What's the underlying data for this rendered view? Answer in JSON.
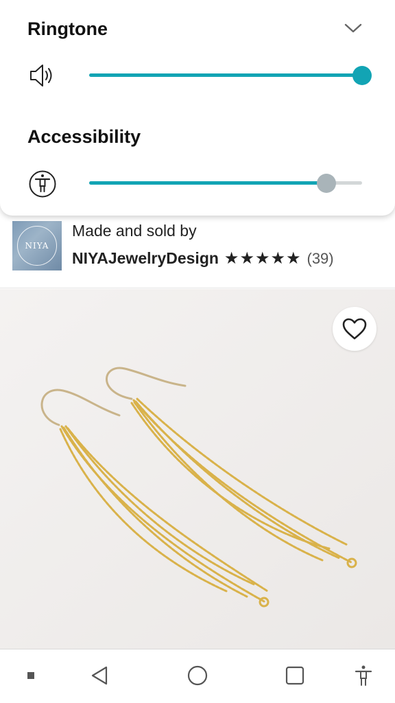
{
  "volume_panel": {
    "ringtone": {
      "title": "Ringtone",
      "level": 1.0
    },
    "accessibility": {
      "title": "Accessibility",
      "level": 0.87
    }
  },
  "seller": {
    "logo_text": "NIYA",
    "made_by_label": "Made and sold by",
    "shop_name": "NIYAJewelryDesign",
    "stars": "★★★★★",
    "rating": 5,
    "review_count": "(39)"
  },
  "product": {
    "image_icon": "gold-chain-earrings"
  },
  "icons": {
    "collapse": "chevron-down-icon",
    "ringtone": "speaker-icon",
    "accessibility": "accessibility-icon",
    "favorite": "heart-icon",
    "nav": [
      "square-dot-icon",
      "back-icon",
      "home-icon",
      "recents-icon",
      "accessibility-icon"
    ]
  },
  "colors": {
    "accent": "#12a4b4",
    "thumb_inactive": "#a9b4b9",
    "gold": "#d9b24a"
  }
}
